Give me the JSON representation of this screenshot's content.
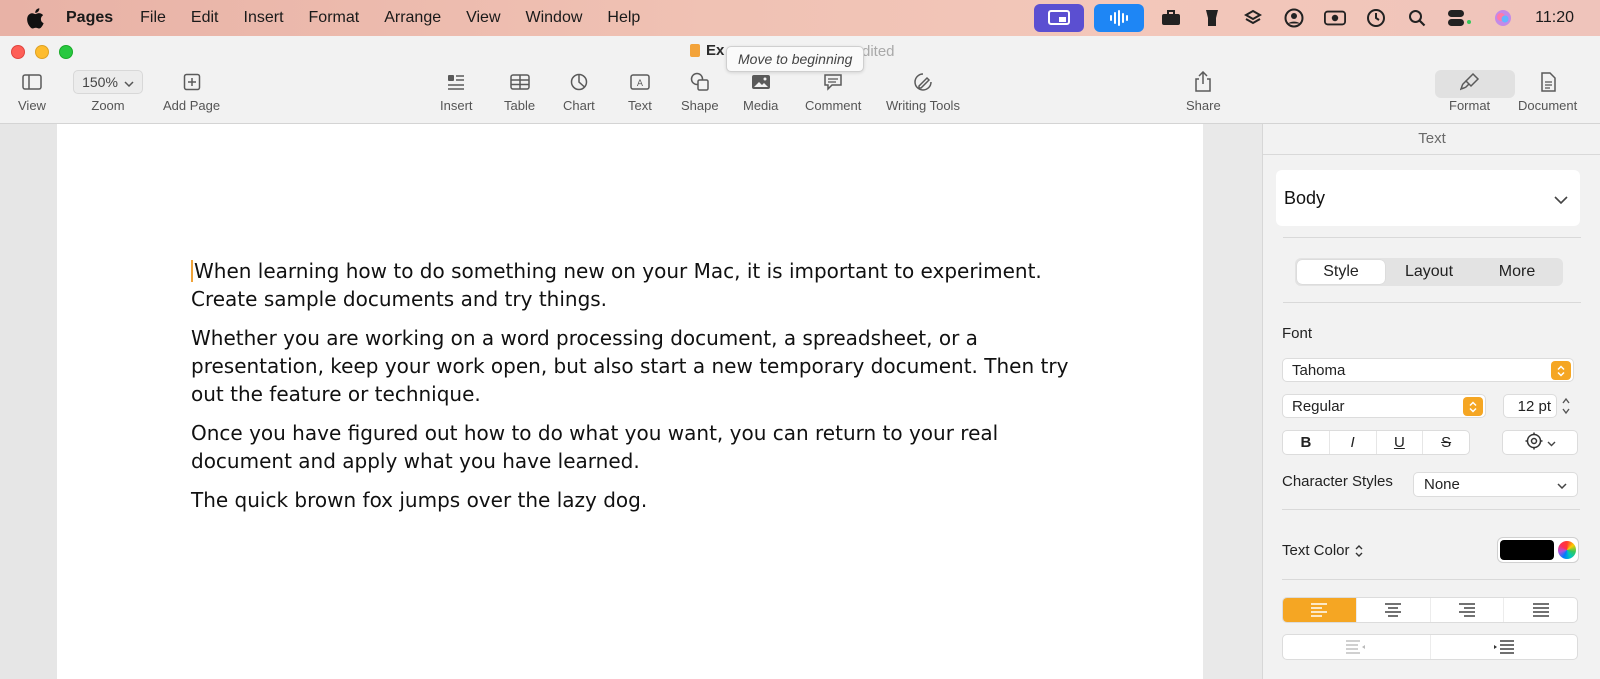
{
  "menubar": {
    "items": [
      "Pages",
      "File",
      "Edit",
      "Insert",
      "Format",
      "Arrange",
      "View",
      "Window",
      "Help"
    ],
    "clock": "11:20",
    "status_icons": [
      "screen-mirroring-icon",
      "voice-control-icon",
      "toolbox-icon",
      "bartender-icon",
      "dropbox-icon",
      "user-icon",
      "screen-record-icon",
      "time-machine-icon",
      "spotlight-icon",
      "control-center-icon",
      "siri-icon"
    ]
  },
  "window": {
    "title": "Ex",
    "edited": "dited",
    "tooltip": "Move to beginning"
  },
  "toolbar": {
    "view": "View",
    "zoom_value": "150%",
    "zoom": "Zoom",
    "add_page": "Add Page",
    "insert": "Insert",
    "table": "Table",
    "chart": "Chart",
    "text": "Text",
    "shape": "Shape",
    "media": "Media",
    "comment": "Comment",
    "writing_tools": "Writing Tools",
    "share": "Share",
    "format": "Format",
    "document": "Document"
  },
  "document": {
    "paragraphs": [
      "When learning how to do something new on your Mac, it is important to experiment. Create sample documents and try things.",
      "Whether you are working on a word processing document, a spreadsheet, or a presentation, keep your work open, but also start a new temporary document. Then try out the feature or technique.",
      "Once you have figured out how to do what you want, you can return to your real document and apply what you have learned.",
      "The quick brown fox jumps over the lazy dog."
    ]
  },
  "inspector": {
    "title": "Text",
    "paragraph_style": "Body",
    "tabs": [
      "Style",
      "Layout",
      "More"
    ],
    "font_label": "Font",
    "font_family": "Tahoma",
    "font_typeface": "Regular",
    "font_size": "12 pt",
    "bius": [
      "B",
      "I",
      "U",
      "S"
    ],
    "character_styles_label": "Character Styles",
    "character_styles_value": "None",
    "text_color_label": "Text Color",
    "text_color": "#000000",
    "accent": "#f5a623"
  }
}
